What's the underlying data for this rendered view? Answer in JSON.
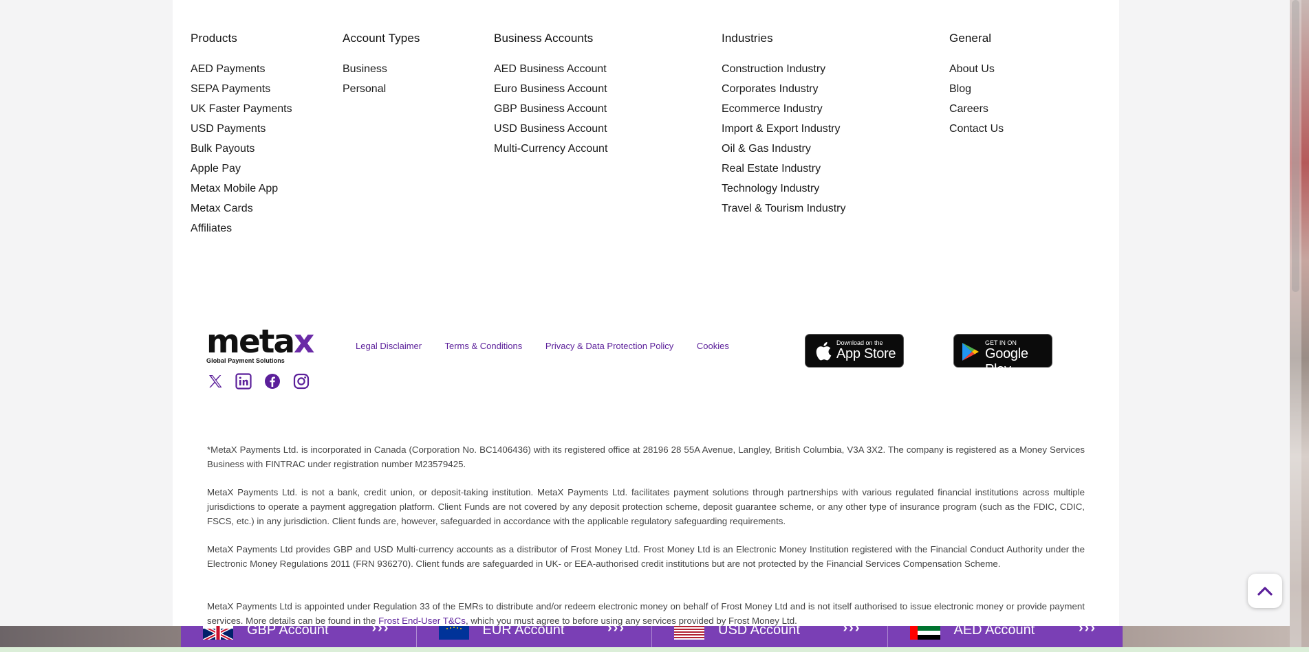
{
  "footer": {
    "columns": [
      {
        "heading": "Products",
        "items": [
          "AED Payments",
          "SEPA Payments",
          "UK Faster Payments",
          "USD Payments",
          "Bulk Payouts",
          "Apple Pay",
          "Metax Mobile App",
          "Metax Cards",
          "Affiliates"
        ]
      },
      {
        "heading": "Account Types",
        "items": [
          "Business",
          "Personal"
        ]
      },
      {
        "heading": "Business Accounts",
        "items": [
          "AED Business Account",
          "Euro Business Account",
          "GBP Business Account",
          "USD Business Account",
          "Multi-Currency Account"
        ]
      },
      {
        "heading": "Industries",
        "items": [
          "Construction Industry",
          "Corporates Industry",
          "Ecommerce Industry",
          "Import & Export Industry",
          "Oil & Gas Industry",
          "Real Estate Industry",
          "Technology Industry",
          "Travel & Tourism Industry"
        ]
      },
      {
        "heading": "General",
        "items": [
          "About Us",
          "Blog",
          "Careers",
          "Contact Us"
        ]
      }
    ],
    "logo": {
      "word_main": "meta",
      "word_x": "x",
      "tagline": "Global Payment Solutions"
    },
    "legal_links": [
      "Legal Disclaimer",
      "Terms & Conditions",
      "Privacy & Data Protection Policy",
      "Cookies"
    ],
    "app_store": {
      "small": "Download on the",
      "big": "App Store"
    },
    "google_play": {
      "small": "GET IN ON",
      "big": "Google Play"
    },
    "social_icons": [
      "x-icon",
      "linkedin-icon",
      "facebook-icon",
      "instagram-icon"
    ],
    "disclaimers": {
      "p1": "*MetaX Payments Ltd. is incorporated in Canada (Corporation No. BC1406436) with its registered office at 28196 28 55A Avenue, Langley, British Columbia, V3A 3X2. The company is registered as a Money Services Business with FINTRAC under registration number M23579425.",
      "p2": "MetaX Payments Ltd. is not a bank, credit union, or deposit-taking institution. MetaX Payments Ltd. facilitates payment solutions through partnerships with various regulated financial institutions across multiple jurisdictions to operate a payment aggregation platform. Client Funds are not covered by any deposit protection scheme, deposit guarantee scheme, or any other type of insurance program (such as the FDIC, CDIC, FSCS, etc.) in any jurisdiction. Client funds are, however, safeguarded in accordance with the applicable regulatory safeguarding requirements.",
      "p3": "MetaX Payments Ltd provides GBP and USD Multi-currency accounts as a distributor of Frost Money Ltd. Frost Money Ltd is an Electronic Money Institution registered with the Financial Conduct Authority under the Electronic Money Regulations 2011 (FRN 936270). Client funds are safeguarded in UK- or EEA-authorised credit institutions but are not protected by the Financial Services Compensation Scheme.",
      "p4_before": "MetaX Payments Ltd is appointed under Regulation 33 of the EMRs to distribute and/or redeem electronic money on behalf of Frost Money Ltd and is not itself authorised to issue electronic money or provide payment services. More details can be found in the ",
      "p4_link": "Frost End-User T&Cs",
      "p4_after": ", which you must agree to before using any services provided by Frost Money Ltd."
    }
  },
  "account_bar": [
    {
      "label": "GBP Account",
      "flag": "uk-flag-icon",
      "arrows": "›››"
    },
    {
      "label": "EUR Account",
      "flag": "eu-flag-icon",
      "arrows": "›››"
    },
    {
      "label": "USD Account",
      "flag": "us-flag-icon",
      "arrows": "›››"
    },
    {
      "label": "AED Account",
      "flag": "uae-flag-icon",
      "arrows": "›››"
    }
  ],
  "colors": {
    "brand_purple": "#5b1f9a",
    "bar_purple": "#7a3fb5"
  }
}
